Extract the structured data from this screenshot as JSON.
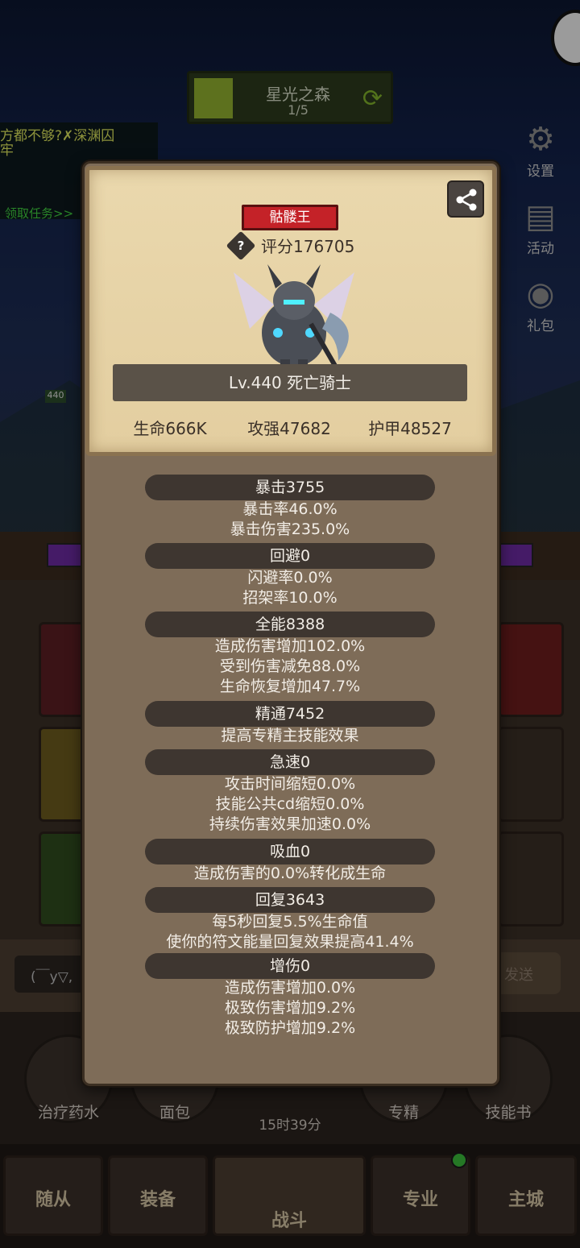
{
  "background": {
    "level_name": "星光之森",
    "level_progress": "1/5",
    "quest_text": "方都不够?✗深渊囚牢",
    "quest_link": "领取任务>>",
    "side_buttons": [
      {
        "label": "设置",
        "icon": "gear-icon"
      },
      {
        "label": "活动",
        "icon": "scroll-icon"
      },
      {
        "label": "礼包",
        "icon": "gift-icon"
      }
    ],
    "level_badge": "440",
    "chat_placeholder": "(￣y▽,",
    "chat_send": "发送",
    "items": [
      {
        "label": "治疗药水"
      },
      {
        "label": "面包"
      },
      {
        "label": "专精"
      },
      {
        "label": "技能书"
      }
    ],
    "timer": "15时39分",
    "nav_tabs": [
      "随从",
      "装备",
      "战斗",
      "专业",
      "主城"
    ]
  },
  "card": {
    "title_tag": "骷髅王",
    "score": "评分176705",
    "hero_name": "Lv.440 死亡骑士",
    "hp": "生命666K",
    "attack": "攻强47682",
    "armor": "护甲48527"
  },
  "stats": [
    {
      "header": "暴击3755",
      "lines": [
        "暴击率46.0%",
        "暴击伤害235.0%"
      ]
    },
    {
      "header": "回避0",
      "lines": [
        "闪避率0.0%",
        "招架率10.0%"
      ]
    },
    {
      "header": "全能8388",
      "lines": [
        "造成伤害增加102.0%",
        "受到伤害减免88.0%",
        "生命恢复增加47.7%"
      ]
    },
    {
      "header": "精通7452",
      "lines": [
        "提高专精主技能效果"
      ]
    },
    {
      "header": "急速0",
      "lines": [
        "攻击时间缩短0.0%",
        "技能公共cd缩短0.0%",
        "持续伤害效果加速0.0%"
      ]
    },
    {
      "header": "吸血0",
      "lines": [
        "造成伤害的0.0%转化成生命"
      ]
    },
    {
      "header": "回复3643",
      "lines": [
        "每5秒回复5.5%生命值",
        "使你的符文能量回复效果提高41.4%"
      ]
    },
    {
      "header": "增伤0",
      "lines": [
        "造成伤害增加0.0%",
        "极致伤害增加9.2%",
        "极致防护增加9.2%"
      ]
    }
  ]
}
